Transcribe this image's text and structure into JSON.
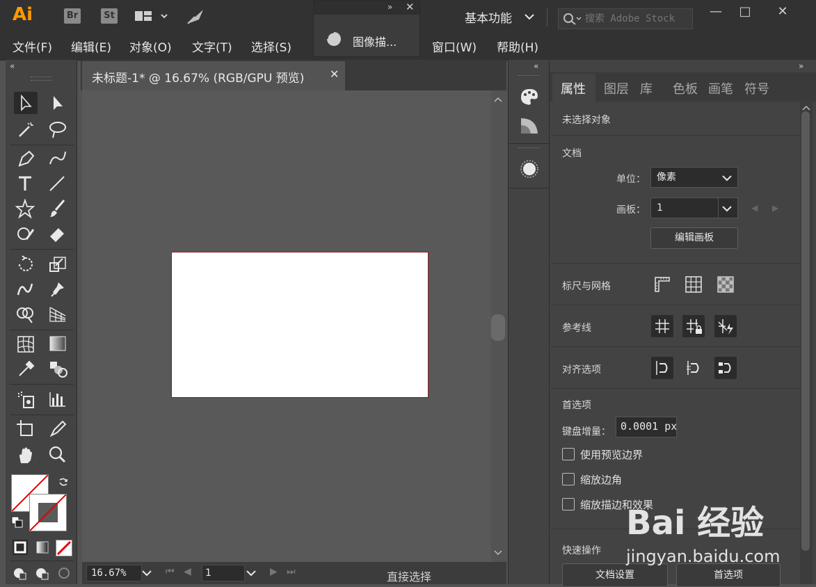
{
  "app": {
    "logo": "Ai",
    "bridge": "Br",
    "stock": "St",
    "workspace": "基本功能",
    "search_placeholder": "搜索 Adobe Stock"
  },
  "menu": [
    "文件(F)",
    "编辑(E)",
    "对象(O)",
    "文字(T)",
    "选择(S)",
    "窗口(W)",
    "帮助(H)"
  ],
  "float_panel": {
    "label": "图像描..."
  },
  "document": {
    "tab_title": "未标题-1* @ 16.67% (RGB/GPU 预览)",
    "zoom": "16.67%",
    "page": "1",
    "status": "直接选择"
  },
  "right_panel": {
    "tabs": [
      "属性",
      "图层",
      "库",
      "色板",
      "画笔",
      "符号"
    ],
    "no_selection": "未选择对象",
    "doc_section": "文档",
    "unit_label": "单位：",
    "unit_value": "像素",
    "artboard_label": "画板：",
    "artboard_value": "1",
    "edit_artboard": "编辑画板",
    "rulers_grid": "标尺与网格",
    "guides": "参考线",
    "align_options": "对齐选项",
    "preferences": "首选项",
    "keyboard_inc_label": "键盘增量：",
    "keyboard_inc_value": "0.0001 px",
    "checkboxes": [
      "使用预览边界",
      "缩放边角",
      "缩放描边和效果"
    ],
    "quick_actions": "快速操作",
    "doc_settings": "文档设置",
    "prefs_button": "首选项"
  },
  "watermark": {
    "brand": "Bai 经验",
    "url": "jingyan.baidu.com"
  },
  "colors": {
    "accent_ai": "#ff9a00",
    "bg_dark": "#323232",
    "panel": "#434343",
    "artboard": "#ffffff"
  }
}
